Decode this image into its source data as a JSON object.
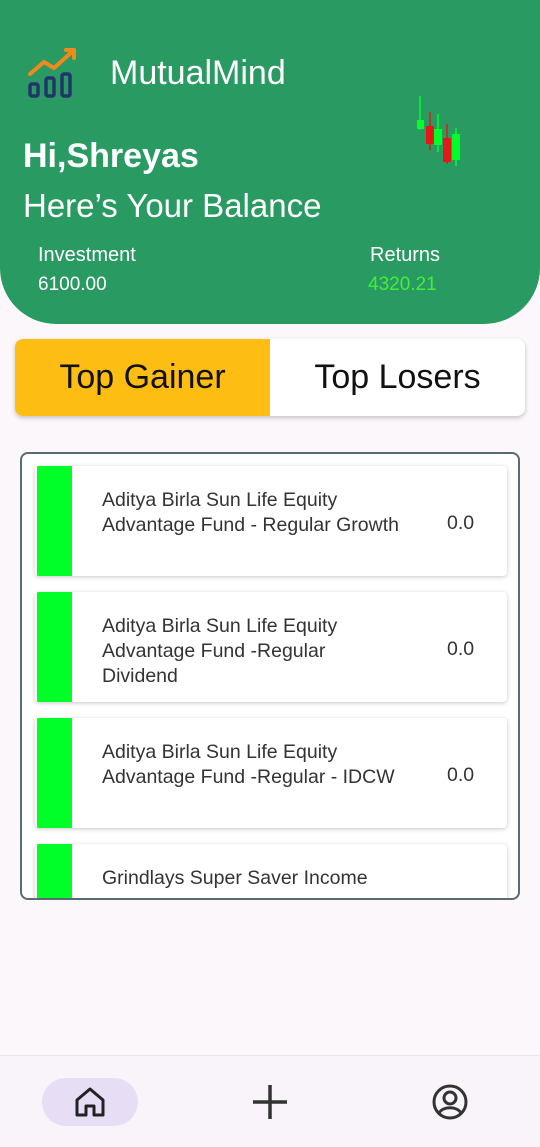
{
  "app": {
    "title": "MutualMind"
  },
  "header": {
    "greeting": "Hi,Shreyas",
    "subtitle": "Here’s Your Balance",
    "investment_label": "Investment",
    "investment_value": "6100.00",
    "returns_label": "Returns",
    "returns_value": "4320.21"
  },
  "icons": {
    "logo": "bar-chart-trend-icon",
    "decor": "candlestick-chart-icon",
    "nav": [
      "home-icon",
      "plus-icon",
      "account-circle-icon"
    ]
  },
  "tabs": [
    {
      "label": "Top Gainer",
      "active": true
    },
    {
      "label": "Top Losers",
      "active": false
    }
  ],
  "funds": [
    {
      "name": "Aditya Birla Sun Life Equity Advantage Fund - Regular Growth",
      "value": "0.0"
    },
    {
      "name": "Aditya Birla Sun Life Equity Advantage Fund -Regular Dividend",
      "value": "0.0"
    },
    {
      "name": "Aditya Birla Sun Life Equity Advantage Fund -Regular - IDCW",
      "value": "0.0"
    },
    {
      "name": "Grindlays Super Saver Income",
      "value": ""
    }
  ],
  "colors": {
    "header_green": "#2a9a63",
    "returns_green": "#3ff03a",
    "active_tab_yellow": "#fdbd12",
    "fund_bar_green": "#00ff29",
    "logo_navy": "#22346a",
    "logo_orange": "#f08a1c",
    "nav_pill": "#e7def6"
  }
}
